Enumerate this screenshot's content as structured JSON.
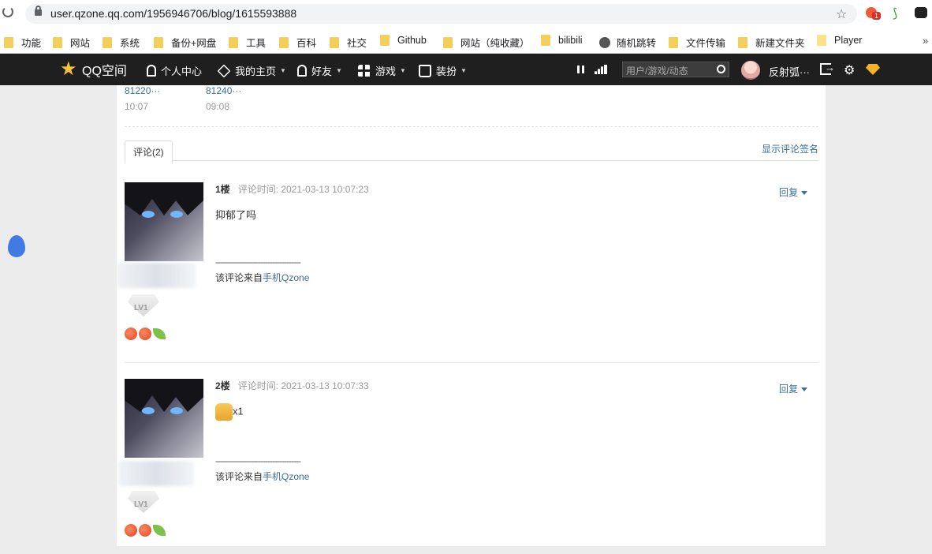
{
  "browser": {
    "url": "user.qzone.qq.com/1956946706/blog/1615593888",
    "extension_badge": "1",
    "bookmarks": [
      "功能",
      "网站",
      "系统",
      "备份+网盘",
      "工具",
      "百科",
      "社交",
      "Github",
      "网站（纯收藏）",
      "bilibili",
      "随机跳转",
      "文件传输",
      "新建文件夹",
      "Player"
    ],
    "more_bookmarks": "»"
  },
  "qzone": {
    "logo_text": "QQ空间",
    "nav": [
      "个人中心",
      "我的主页",
      "好友",
      "游戏",
      "装扮"
    ],
    "search_placeholder": "用户/游戏/动态",
    "username": "反射弧···"
  },
  "prev_posts": [
    {
      "id": "81220···",
      "time": "10:07"
    },
    {
      "id": "81240···",
      "time": "09:08"
    }
  ],
  "comments_section": {
    "tab_label": "评论(2)",
    "show_signature": "显示评论签名",
    "reply_label": "回复",
    "comments": [
      {
        "floor": "1楼",
        "time": "评论时间: 2021-03-13 10:07:23",
        "text": "抑郁了吗",
        "separator": "------------------------------------",
        "from_prefix": "该评论来自",
        "from_link": "手机Qzone",
        "level": "LV1"
      },
      {
        "floor": "2楼",
        "time": "评论时间: 2021-03-13 10:07:33",
        "text": "x1",
        "separator": "------------------------------------",
        "from_prefix": "该评论来自",
        "from_link": "手机Qzone",
        "level": "LV1"
      }
    ]
  }
}
